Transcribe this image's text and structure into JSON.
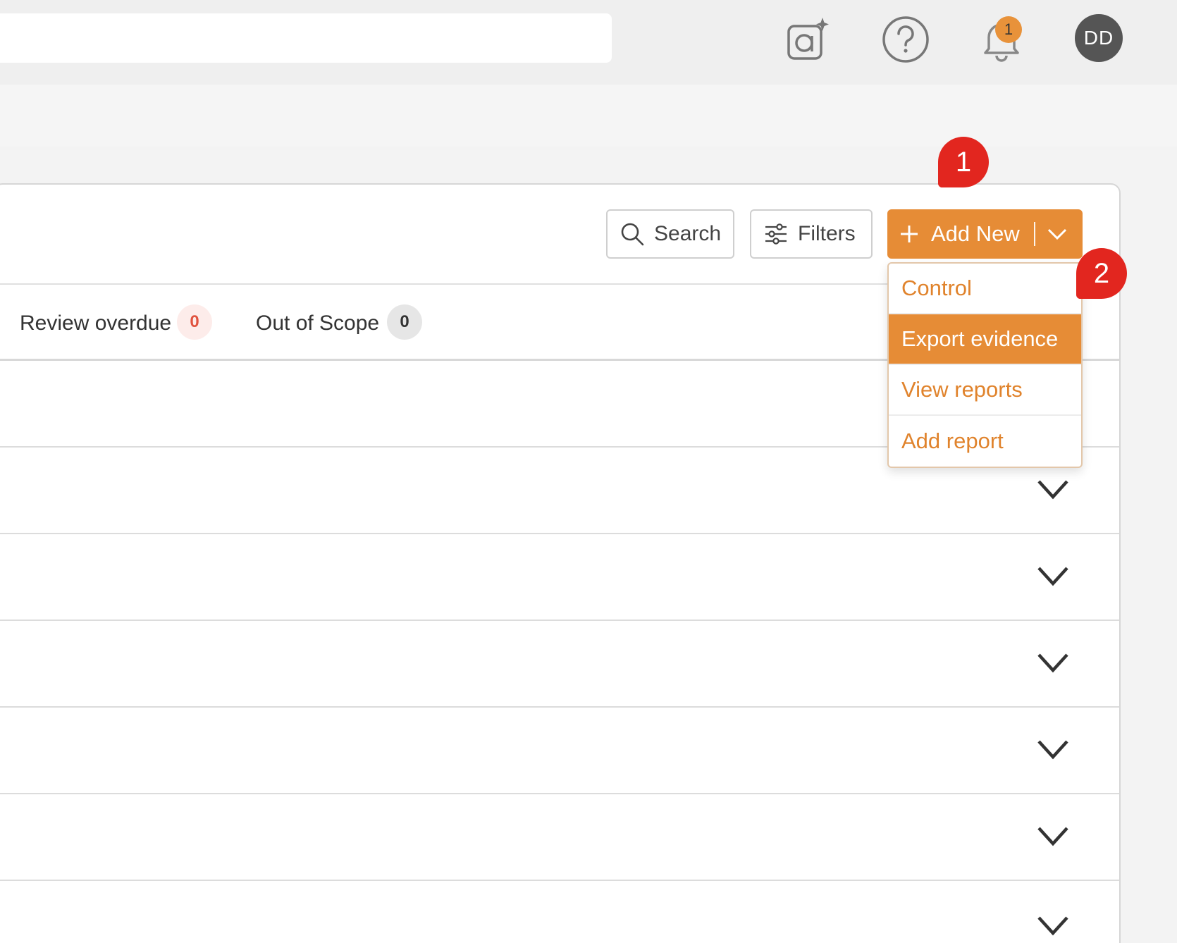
{
  "header": {
    "avatar_initials": "DD",
    "notification_count": "1"
  },
  "toolbar": {
    "search_label": "Search",
    "filters_label": "Filters",
    "add_new_label": "Add New"
  },
  "tabs": [
    {
      "label": "Review overdue",
      "count": "0"
    },
    {
      "label": "Out of Scope",
      "count": "0"
    }
  ],
  "dropdown": {
    "items": [
      {
        "label": "Control"
      },
      {
        "label": "Export evidence"
      },
      {
        "label": "View reports"
      },
      {
        "label": "Add report"
      }
    ],
    "highlighted": "Export evidence"
  },
  "markers": {
    "first": "1",
    "second": "2"
  },
  "colors": {
    "accent": "#e68c36",
    "marker": "#e2261f",
    "overdue": "#e0533f"
  }
}
